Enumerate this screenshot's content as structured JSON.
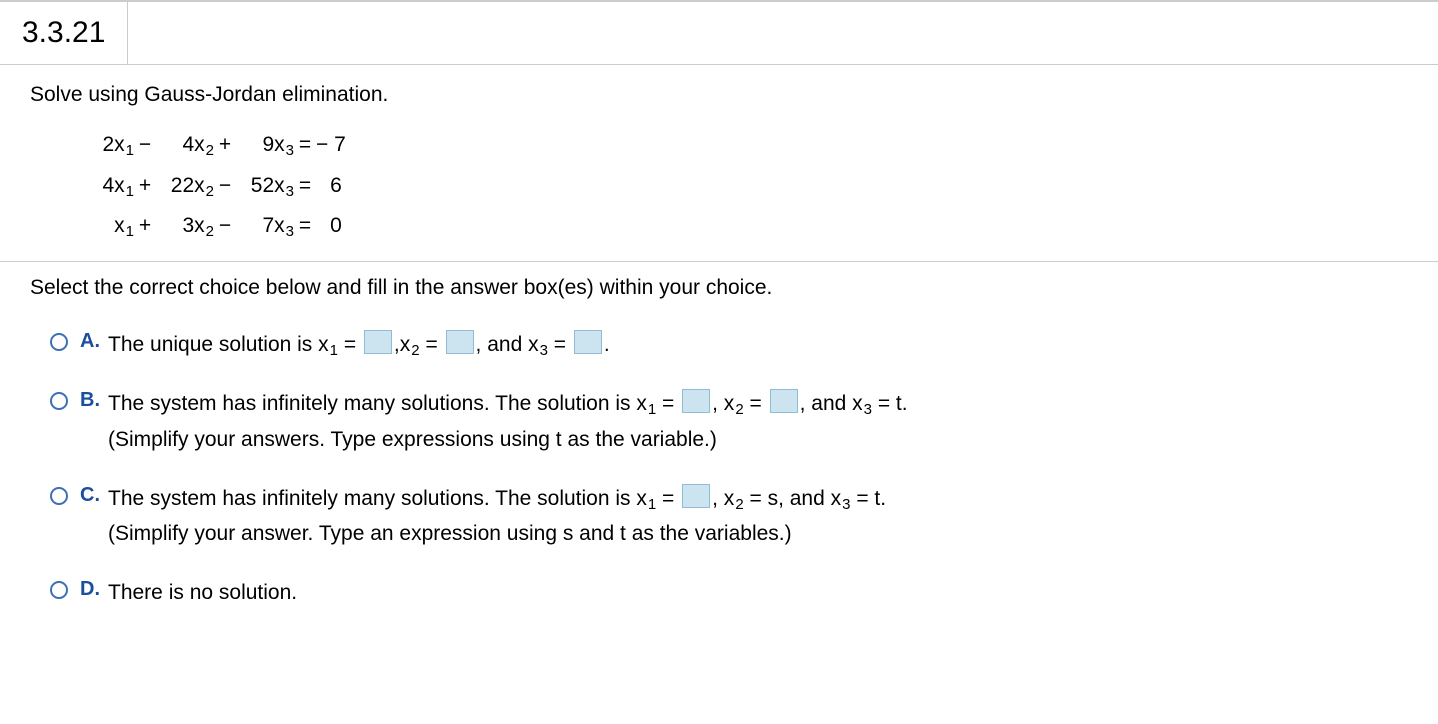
{
  "qnum": "3.3.21",
  "prompt": "Solve using Gauss-Jordan elimination.",
  "eq": {
    "r1": {
      "c1": "2x",
      "o1": "−",
      "c2": "4x",
      "o2": "+",
      "c3": "9x",
      "eq": "=",
      "rhs": "− 7"
    },
    "r2": {
      "c1": "4x",
      "o1": "+",
      "c2": "22x",
      "o2": "−",
      "c3": "52x",
      "eq": "=",
      "rhs": "6"
    },
    "r3": {
      "c1": "x",
      "o1": "+",
      "c2": "3x",
      "o2": "−",
      "c3": "7x",
      "eq": "=",
      "rhs": "0"
    }
  },
  "select": "Select the correct choice below and fill in the answer box(es) within your choice.",
  "A": {
    "l": "A.",
    "t1": "The unique solution is x",
    "t2": " = ",
    "t3": ",x",
    "t4": " = ",
    "t5": ", and x",
    "t6": " = ",
    "t7": "."
  },
  "B": {
    "l": "B.",
    "t1": "The system has infinitely many solutions. The solution is x",
    "t2": " = ",
    "t3": ", x",
    "t4": " = ",
    "t5": ", and x",
    "t6": " = t.",
    "h": "(Simplify your answers. Type expressions using t as the variable.)"
  },
  "C": {
    "l": "C.",
    "t1": "The system has infinitely many solutions. The solution is x",
    "t2": " = ",
    "t3": ", x",
    "t4": " = s, and x",
    "t5": " = t.",
    "h": "(Simplify your answer. Type an expression using s and t as the variables.)"
  },
  "D": {
    "l": "D.",
    "t": "There is no solution."
  },
  "s": {
    "1": "1",
    "2": "2",
    "3": "3"
  }
}
